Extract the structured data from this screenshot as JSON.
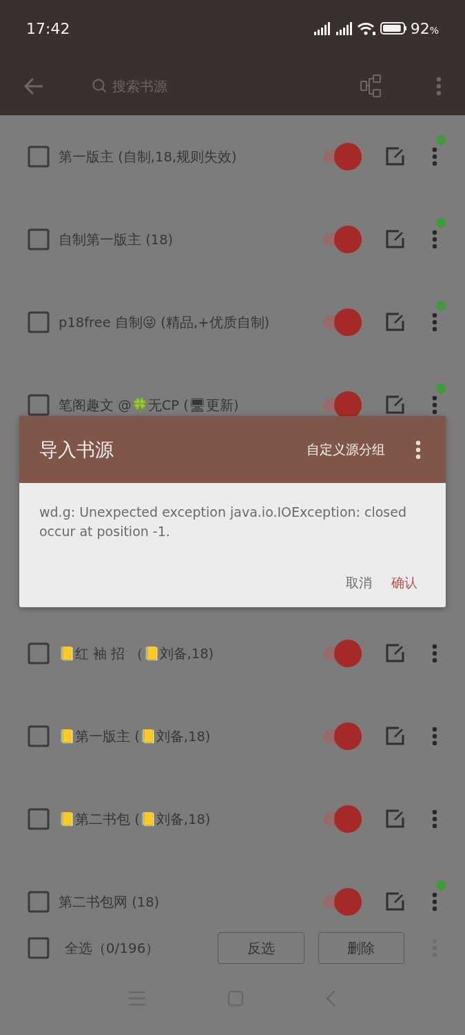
{
  "status_bar": {
    "time": "17:42",
    "battery": "92",
    "battery_unit": "%"
  },
  "toolbar": {
    "search_placeholder": "搜索书源"
  },
  "sources": [
    {
      "title": "第一版主 (自制,18,规则失效)",
      "checked": false,
      "enabled": true,
      "dot": true
    },
    {
      "title": "自制第一版主 (18)",
      "checked": false,
      "enabled": true,
      "dot": true
    },
    {
      "title": "p18free 自制😜 (精品,+优质自制)",
      "checked": false,
      "enabled": true,
      "dot": true
    },
    {
      "title": "笔阁趣文 @🍀无CP (🖥更新)",
      "checked": false,
      "enabled": true,
      "dot": true
    },
    {
      "title": "📒红 袖 招 （📒刘备,18)",
      "checked": false,
      "enabled": true,
      "dot": false
    },
    {
      "title": "📒第一版主 (📒刘备,18)",
      "checked": false,
      "enabled": true,
      "dot": false
    },
    {
      "title": "📒第二书包 (📒刘备,18)",
      "checked": false,
      "enabled": true,
      "dot": false
    },
    {
      "title": "第二书包网 (18)",
      "checked": false,
      "enabled": true,
      "dot": true
    }
  ],
  "select_bar": {
    "label": "全选（0/196）",
    "checked": false,
    "buttons": [
      "反选",
      "删除"
    ]
  },
  "dialog": {
    "title": "导入书源",
    "action": "自定义源分组",
    "message": "wd.g: Unexpected exception java.io.IOException: closed occur at position -1.",
    "buttons": [
      {
        "label": "取消",
        "kind": "cancel"
      },
      {
        "label": "确认",
        "kind": "confirm"
      }
    ]
  }
}
